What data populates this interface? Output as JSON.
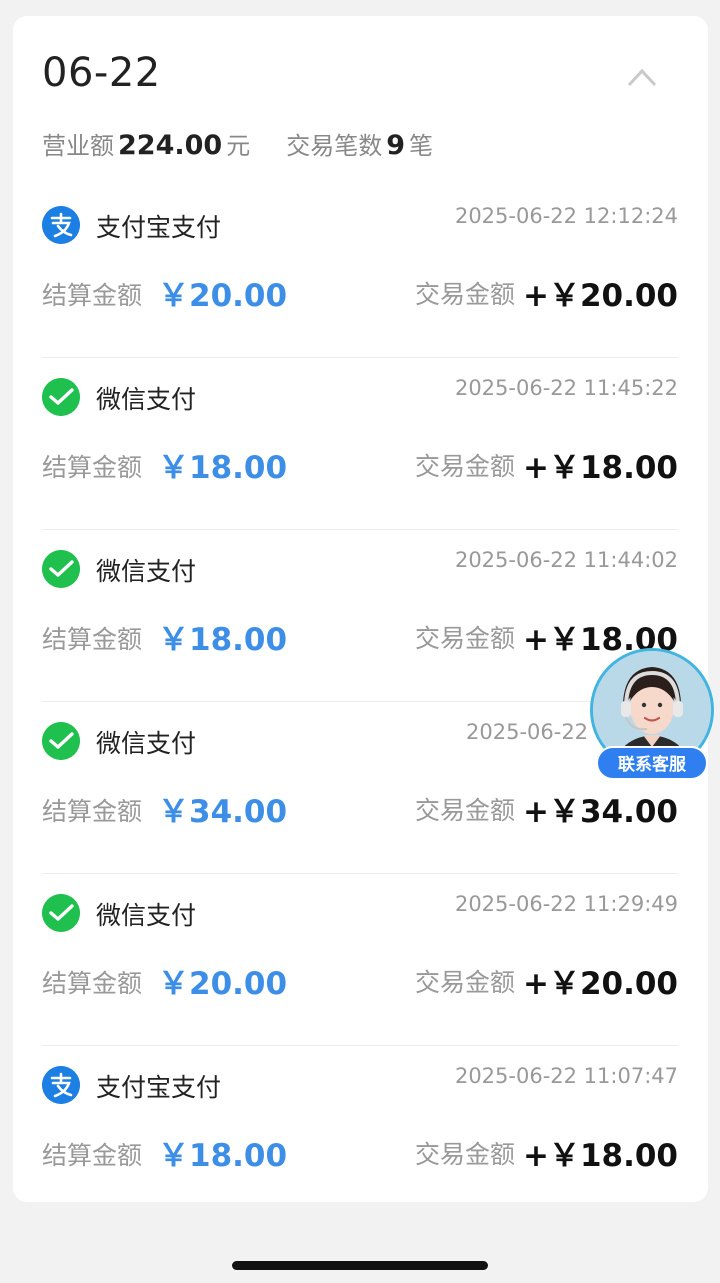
{
  "header": {
    "date": "06-22",
    "revenue_label": "营业额",
    "revenue_value": "224.00",
    "revenue_unit": "元",
    "count_label": "交易笔数",
    "count_value": "9",
    "count_unit": "笔"
  },
  "labels": {
    "settle": "结算金额",
    "trade": "交易金额"
  },
  "transactions": [
    {
      "method": "支付宝支付",
      "icon": "alipay-icon",
      "time": "2025-06-22 12:12:24",
      "settle": "￥20.00",
      "trade": "+￥20.00"
    },
    {
      "method": "微信支付",
      "icon": "wechat-pay-icon",
      "time": "2025-06-22 11:45:22",
      "settle": "￥18.00",
      "trade": "+￥18.00"
    },
    {
      "method": "微信支付",
      "icon": "wechat-pay-icon",
      "time": "2025-06-22 11:44:02",
      "settle": "￥18.00",
      "trade": "+￥18.00"
    },
    {
      "method": "微信支付",
      "icon": "wechat-pay-icon",
      "time": "2025-06-22",
      "settle": "￥34.00",
      "trade": "+￥34.00"
    },
    {
      "method": "微信支付",
      "icon": "wechat-pay-icon",
      "time": "2025-06-22 11:29:49",
      "settle": "￥20.00",
      "trade": "+￥20.00"
    },
    {
      "method": "支付宝支付",
      "icon": "alipay-icon",
      "time": "2025-06-22 11:07:47",
      "settle": "￥18.00",
      "trade": "+￥18.00"
    }
  ],
  "customer_service": {
    "label": "联系客服",
    "icon": "agent-avatar-icon"
  },
  "colors": {
    "accent_blue": "#3d8ee6",
    "alipay_blue": "#1b7fe3",
    "wechat_green": "#20c04f"
  }
}
